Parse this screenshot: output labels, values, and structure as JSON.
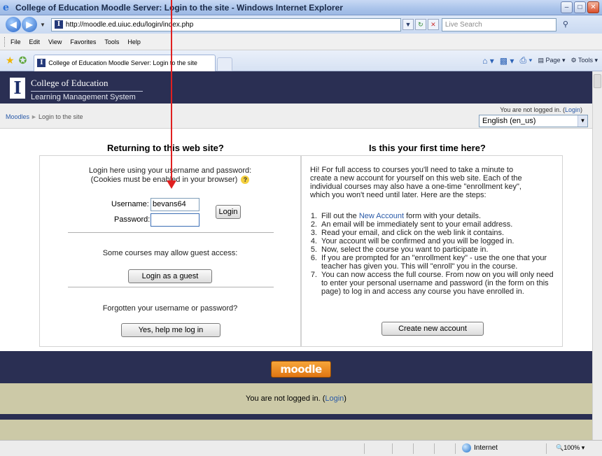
{
  "window": {
    "title": "College of Education Moodle Server: Login to the site - Windows Internet Explorer"
  },
  "addressbar": {
    "url": "http://moodle.ed.uiuc.edu/login/index.php",
    "search_placeholder": "Live Search"
  },
  "menubar": {
    "items": [
      "File",
      "Edit",
      "View",
      "Favorites",
      "Tools",
      "Help"
    ]
  },
  "tab": {
    "label": "College of Education Moodle Server: Login to the site"
  },
  "commandbar": {
    "page_label": "Page",
    "tools_label": "Tools"
  },
  "site_header": {
    "college": "College of Education",
    "system": "Learning Management System"
  },
  "navbar": {
    "crumb_root": "Moodles",
    "crumb_current": "Login to the site",
    "login_info_prefix": "You are not logged in. (",
    "login_link": "Login",
    "login_info_suffix": ")",
    "language": "English (en_us)"
  },
  "returning": {
    "title": "Returning to this web site?",
    "intro_line1": "Login here using your username and password:",
    "intro_line2": "(Cookies must be enabled in your browser)",
    "username_label": "Username:",
    "username_value": "bevans64",
    "password_label": "Password:",
    "password_value": "",
    "login_button": "Login",
    "guest_text": "Some courses may allow guest access:",
    "guest_button": "Login as a guest",
    "forgot_text": "Forgotten your username or password?",
    "forgot_button": "Yes, help me log in"
  },
  "first_time": {
    "title": "Is this your first time here?",
    "intro_line1": "Hi! For full access to courses you'll need to take a minute to",
    "intro_line2": "create a new account for yourself on this web site. Each of the",
    "intro_line3": "individual courses may also have a one-time \"enrollment key\",",
    "intro_line4": "which you won't need until later. Here are the steps:",
    "steps": [
      {
        "num": "1.",
        "lines": [
          "Fill out the ",
          "New Account",
          " form with your details."
        ]
      },
      {
        "num": "2.",
        "lines": [
          "An email will be immediately sent to your email address."
        ]
      },
      {
        "num": "3.",
        "lines": [
          "Read your email, and click on the web link it contains."
        ]
      },
      {
        "num": "4.",
        "lines": [
          "Your account will be confirmed and you will be logged in."
        ]
      },
      {
        "num": "5.",
        "lines": [
          "Now, select the course you want to participate in."
        ]
      },
      {
        "num": "6.",
        "lines": [
          "If you are prompted for an \"enrollment key\" - use the one that your teacher has given you. This will \"enroll\" you in the course."
        ]
      },
      {
        "num": "7.",
        "lines": [
          "You can now access the full course. From now on you will only need to enter your personal username and password (in the form on this page) to log in and access any course you have enrolled in."
        ]
      }
    ],
    "create_button": "Create new account"
  },
  "footer": {
    "logo": "moodle",
    "login_info_prefix": "You are not logged in. (",
    "login_link": "Login",
    "login_info_suffix": ")"
  },
  "statusbar": {
    "zone": "Internet",
    "zoom": "100%"
  },
  "colors": {
    "header_bg": "#2a2f53",
    "footer_band": "#ccc9a7",
    "link": "#2a5aa8",
    "annotation_arrow": "#e02020"
  }
}
